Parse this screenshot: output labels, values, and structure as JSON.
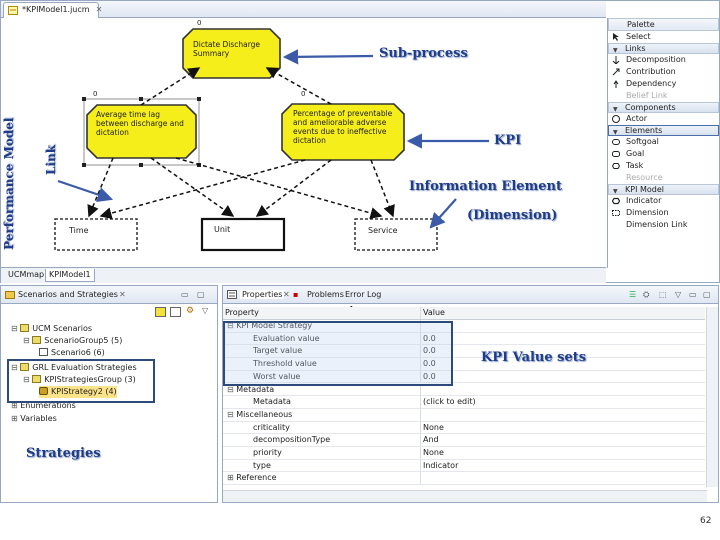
{
  "editor": {
    "tab_label": "*KPIModel1.jucm",
    "bottom_tabs": [
      "UCMmap",
      "KPIModel1"
    ]
  },
  "diagram": {
    "root_goal": {
      "label": "Dictate Discharge Summary",
      "weight": "0"
    },
    "left_goal": {
      "label": "Average time lag between discharge and dictation",
      "weight": "0"
    },
    "right_goal": {
      "label": "Percentage of preventable and ameliorable adverse events due to ineffective dictation",
      "weight": "0"
    },
    "info_elements": [
      "Time",
      "Unit",
      "Service"
    ],
    "vertical_label_model": "Performance Model",
    "vertical_label_link": "Link"
  },
  "palette": {
    "title": "Palette",
    "select": "Select",
    "links_drawer": "Links",
    "links_items": [
      "Decomposition",
      "Contribution",
      "Dependency",
      "Belief Link"
    ],
    "components_drawer": "Components",
    "components_items": [
      "Actor"
    ],
    "elements_drawer": "Elements",
    "elements_items": [
      "Softgoal",
      "Goal",
      "Task",
      "Resource"
    ],
    "kpi_drawer": "KPI Model",
    "kpi_items": [
      "Indicator",
      "Dimension",
      "Dimension Link"
    ]
  },
  "strategies_view": {
    "tabs": [
      "Scenarios and Strategies"
    ],
    "tree": [
      "UCM Scenarios",
      "ScenarioGroup5 (5)",
      "Scenario6 (6)",
      "GRL Evaluation Strategies",
      "KPIStrategiesGroup (3)",
      "KPIStrategy2 (4)",
      "Enumerations",
      "Variables"
    ]
  },
  "properties_view": {
    "tabs": [
      "Properties",
      "Problems",
      "Error Log"
    ],
    "columns": [
      "Property",
      "Value"
    ],
    "rows": [
      {
        "p": "KPI Model Strategy",
        "v": ""
      },
      {
        "p": "Evaluation value",
        "v": "0.0"
      },
      {
        "p": "Target value",
        "v": "0.0"
      },
      {
        "p": "Threshold value",
        "v": "0.0"
      },
      {
        "p": "Worst value",
        "v": "0.0"
      },
      {
        "p": "Metadata",
        "v": ""
      },
      {
        "p": "Metadata",
        "v": "(click to edit)"
      },
      {
        "p": "Miscellaneous",
        "v": ""
      },
      {
        "p": "criticality",
        "v": "None"
      },
      {
        "p": "decompositionType",
        "v": "And"
      },
      {
        "p": "priority",
        "v": "None"
      },
      {
        "p": "type",
        "v": "Indicator"
      },
      {
        "p": "Reference",
        "v": ""
      }
    ]
  },
  "annotations": {
    "sub_process": "Sub-process",
    "kpi": "KPI",
    "information_element": "Information Element",
    "dimension": "(Dimension)",
    "kpi_value_sets": "KPI Value sets",
    "strategies": "Strategies"
  },
  "page_number": "62",
  "colors": {
    "goal_fill": "#f6ee1a",
    "goal_stroke": "#333333",
    "annotation": "#1f3c88",
    "highlight": "#2d4b7a"
  }
}
